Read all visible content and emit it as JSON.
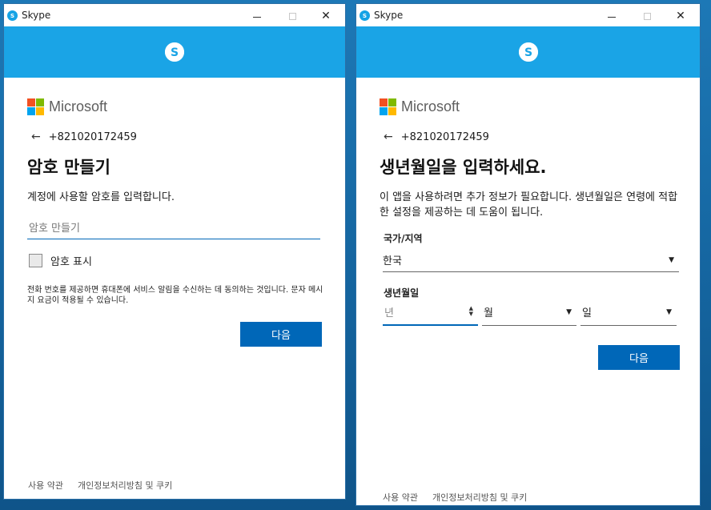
{
  "app_title": "Skype",
  "brand": {
    "name": "Microsoft"
  },
  "colors": {
    "banner": "#1aa4e6",
    "accent": "#0067b8",
    "ms_red": "#f25022",
    "ms_green": "#7fba00",
    "ms_blue": "#00a4ef",
    "ms_yellow": "#ffb900"
  },
  "icons": {
    "title": "skype-icon",
    "banner": "skype-logo-icon",
    "back": "arrow-left-icon",
    "minimize": "minimize-icon",
    "maximize": "maximize-icon",
    "close": "close-icon"
  },
  "left": {
    "window_title": "Skype",
    "phone": "+821020172459",
    "heading": "암호 만들기",
    "description": "계정에 사용할 암호를 입력합니다.",
    "password_placeholder": "암호 만들기",
    "show_password_label": "암호 표시",
    "fine_print": "전화 번호를 제공하면 휴대폰에 서비스 알림을 수신하는 데 동의하는 것입니다. 문자 메시지 요금이 적용될 수 있습니다.",
    "next_button": "다음",
    "footer": {
      "terms": "사용 약관",
      "privacy": "개인정보처리방침 및 쿠키"
    }
  },
  "right": {
    "window_title": "Skype",
    "phone": "+821020172459",
    "heading": "생년월일을 입력하세요.",
    "description": "이 앱을 사용하려면 추가 정보가 필요합니다. 생년월일은 연령에 적합한 설정을 제공하는 데 도움이 됩니다.",
    "country_label": "국가/지역",
    "country_value": "한국",
    "birthdate_label": "생년월일",
    "year_placeholder": "년",
    "month_value": "월",
    "day_value": "일",
    "next_button": "다음",
    "footer": {
      "terms": "사용 약관",
      "privacy": "개인정보처리방침 및 쿠키"
    }
  }
}
